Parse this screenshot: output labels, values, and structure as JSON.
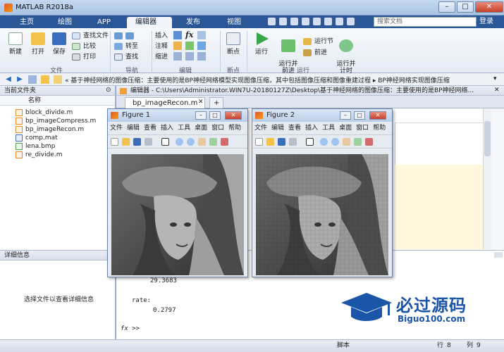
{
  "window": {
    "title": "MATLAB R2018a",
    "minimize": "–",
    "maximize": "□",
    "close": "✕"
  },
  "ribbon_tabs": [
    {
      "label": "主页"
    },
    {
      "label": "绘图"
    },
    {
      "label": "APP"
    },
    {
      "label": "编辑器",
      "active": true
    },
    {
      "label": "发布"
    },
    {
      "label": "视图"
    }
  ],
  "search": {
    "placeholder": "搜索文档"
  },
  "login": "登录",
  "ribbon": {
    "file": {
      "new": "新建",
      "open": "打开",
      "save": "保存",
      "find_files": "查找文件",
      "compare": "比较",
      "print": "打印",
      "group": "文件"
    },
    "navigate": {
      "goto": "转至",
      "find": "查找",
      "group": "导航"
    },
    "edit": {
      "insert": "插入",
      "fx": "fx",
      "comment": "注释",
      "indent": "缩进",
      "group": "编辑"
    },
    "breakpoints": {
      "bp": "断点",
      "group": "断点"
    },
    "run": {
      "run": "运行",
      "run_advance": "运行并\n前进",
      "run_section": "运行节",
      "advance": "前进",
      "run_time": "运行并\n计时",
      "group": "运行"
    }
  },
  "address_path": "« 基于神经网络的图像压缩：主要使用的是BP神经网络模型实现图像压缩，其中包括图像压缩和图像重建过程 ▸ BP神经网络实现图像压缩",
  "current_folder": {
    "title": "当前文件夹",
    "col_name": "名称",
    "files": [
      {
        "name": "block_divide.m",
        "type": "m"
      },
      {
        "name": "bp_imageCompress.m",
        "type": "m"
      },
      {
        "name": "bp_imageRecon.m",
        "type": "m"
      },
      {
        "name": "comp.mat",
        "type": "mat"
      },
      {
        "name": "lena.bmp",
        "type": "bmp"
      },
      {
        "name": "re_divide.m",
        "type": "m"
      }
    ]
  },
  "details": {
    "title": "详细信息",
    "hint": "选择文件以查看详细信息"
  },
  "editor": {
    "header": "编辑器 - C:\\Users\\Administrator.WIN7U-20180127Z\\Desktop\\基于神经网络的图像压缩：主要使用的是BP神经网络...",
    "tab": "bp_imageRecon.m",
    "plus": "+"
  },
  "command": {
    "value1": "29.3683",
    "label_rate": "rate:",
    "value2": "0.2797",
    "prompt": "fx >>"
  },
  "status": {
    "mode": "脚本",
    "row_label": "行",
    "row": "8",
    "col_label": "列",
    "col": "9"
  },
  "figures": [
    {
      "title": "Figure 1"
    },
    {
      "title": "Figure 2"
    }
  ],
  "figure_menu": [
    "文件",
    "编辑",
    "查看",
    "插入",
    "工具",
    "桌面",
    "窗口",
    "帮助"
  ],
  "watermark": {
    "line1": "必过源码",
    "line2": "Biguo100.com"
  }
}
